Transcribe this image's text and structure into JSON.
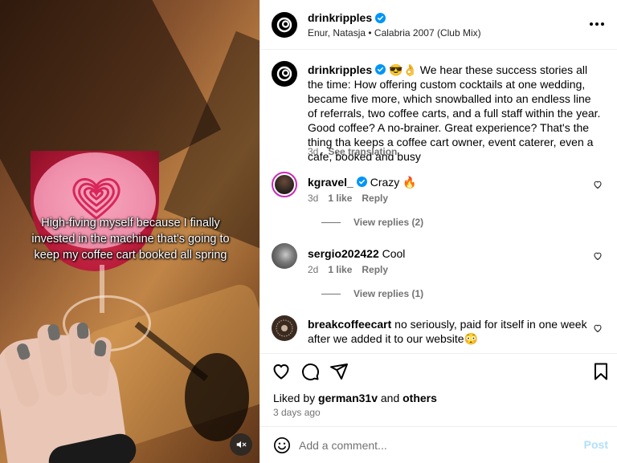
{
  "colors": {
    "link": "#0095f6",
    "muted": "#737373",
    "post_disabled": "#b2dffc",
    "verified": "#0095f6"
  },
  "media": {
    "overlay_text": "High-fiving myself because I finally invested in the machine that's going to keep my coffee cart booked all spring",
    "mute_icon": "speaker-muted-icon"
  },
  "header": {
    "username": "drinkripples",
    "audio": "Enur, Natasja • Calabria 2007 (Club Mix)",
    "more_icon": "more-horizontal-icon"
  },
  "caption": {
    "username": "drinkripples",
    "emoji": "😎👌",
    "text": "We hear these success stories all the time: How offering custom cocktails at one wedding, became five more, which snowballed into an endless line of referrals, two coffee carts, and a full staff within the year. Good coffee? A no-brainer. Great experience? That's the thing tha keeps a coffee cart owner, event caterer, even a cafe, booked and busy",
    "time": "3d",
    "translate": "See translation"
  },
  "comments": [
    {
      "username": "kgravel_",
      "verified": true,
      "text": "Crazy 🔥",
      "time": "3d",
      "likes": "1 like",
      "reply": "Reply",
      "view_replies": "View replies (2)"
    },
    {
      "username": "sergio202422",
      "verified": false,
      "text": "Cool",
      "time": "2d",
      "likes": "1 like",
      "reply": "Reply",
      "view_replies": "View replies (1)"
    },
    {
      "username": "breakcoffeecart",
      "verified": false,
      "text": "no seriously, paid for itself in one week after we added it to our website😳"
    }
  ],
  "actions": {
    "liked_by_prefix": "Liked by",
    "liked_by_user": "german31v",
    "liked_by_and": "and",
    "liked_by_others": "others",
    "time_ago": "3 days ago"
  },
  "composer": {
    "placeholder": "Add a comment...",
    "post_label": "Post"
  }
}
